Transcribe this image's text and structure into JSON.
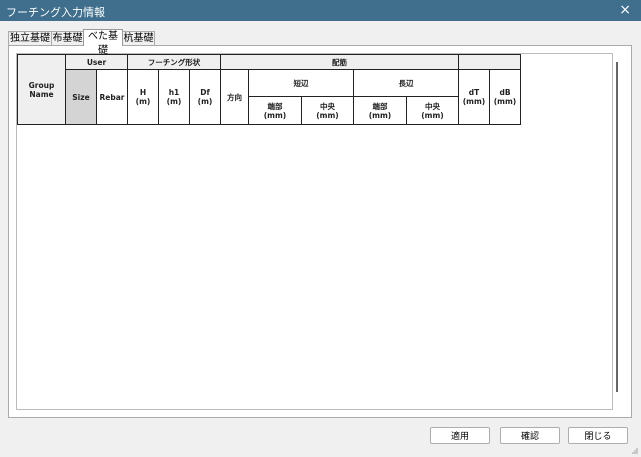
{
  "window": {
    "title": "フーチング入力情報",
    "close_label": "×"
  },
  "tabs": [
    {
      "label": "独立基礎"
    },
    {
      "label": "布基礎"
    },
    {
      "label": "べた基礎"
    },
    {
      "label": "杭基礎"
    }
  ],
  "active_tab": 2,
  "table": {
    "group_name": "Group\nName",
    "user": "User",
    "size": "Size",
    "rebar": "Rebar",
    "footing_shape": "フーチング形状",
    "h": "H\n(m)",
    "h1": "h1\n(m)",
    "df": "Df\n(m)",
    "haikin": "配筋",
    "direction": "方向",
    "short_side": "短辺",
    "long_side": "長辺",
    "short_edge": "端部\n(mm)",
    "short_center": "中央\n(mm)",
    "long_edge": "端部\n(mm)",
    "long_center": "中央\n(mm)",
    "dt": "dT\n(mm)",
    "db": "dB\n(mm)"
  },
  "buttons": {
    "apply": "適用",
    "confirm": "確認",
    "close": "閉じる"
  }
}
